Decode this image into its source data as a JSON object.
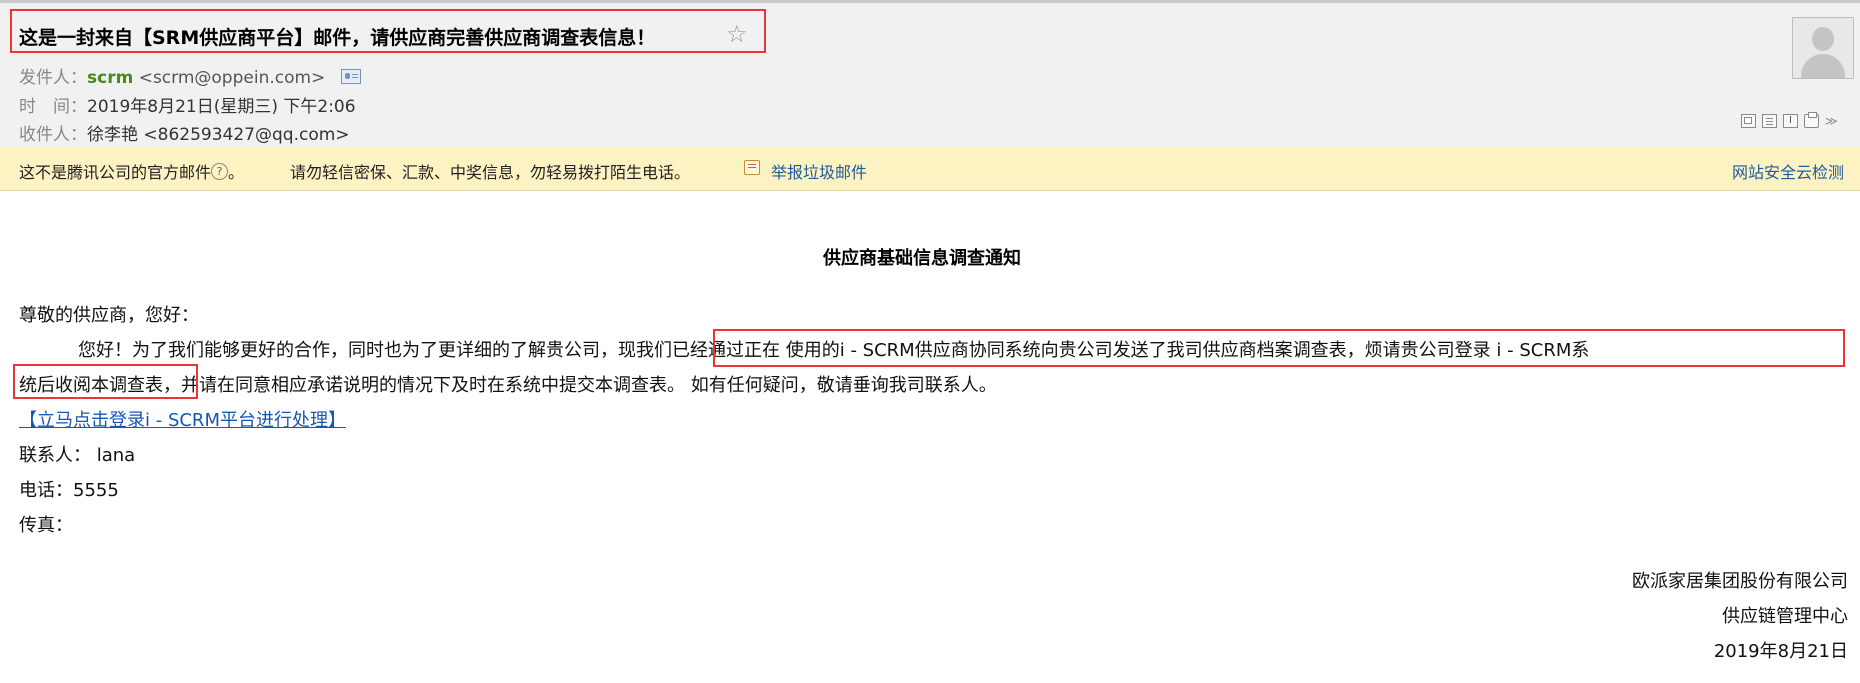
{
  "header": {
    "subject": "这是一封来自【SRM供应商平台】邮件，请供应商完善供应商调查表信息！",
    "star_icon": "☆",
    "from_label": "发件人：",
    "sender_name": "scrm",
    "sender_email": "<scrm@oppein.com>",
    "time_label": "时　间：",
    "time_value": "2019年8月21日(星期三) 下午2:06",
    "to_label": "收件人：",
    "recipient": "徐李艳 <862593427@qq.com>",
    "toolbar_chevron": "≫"
  },
  "warning": {
    "text1": "这不是腾讯公司的官方邮件",
    "help_icon": "?",
    "text1_end": "。",
    "text2": "请勿轻信密保、汇款、中奖信息，勿轻易拨打陌生电话。",
    "report_link": "举报垃圾邮件",
    "security_link": "网站安全云检测",
    "background_color": "#fcf2c2"
  },
  "body": {
    "notice_title": "供应商基础信息调查通知",
    "greeting": "尊敬的供应商，您好：",
    "para_line1": "您好！为了我们能够更好的合作，同时也为了更详细的了解贵公司，现我们已经通过正在 使用的i - SCRM供应商协同系统向贵公司发送了我司供应商档案调查表，烦请贵公司登录 i - SCRM系",
    "para_line2": "统后收阅本调查表，并请在同意相应承诺说明的情况下及时在系统中提交本调查表。 如有任何疑问，敬请垂询我司联系人。",
    "link": "【立马点击登录i - SCRM平台进行处理】",
    "contact": "联系人： lana",
    "phone": "电话：5555",
    "fax": "传真："
  },
  "signature": {
    "company": "欧派家居集团股份有限公司",
    "department": "供应链管理中心",
    "date": "2019年8月21日"
  },
  "colors": {
    "highlight_border": "#e8363b",
    "sender_name": "#4c8a1c",
    "link": "#1558b0"
  }
}
